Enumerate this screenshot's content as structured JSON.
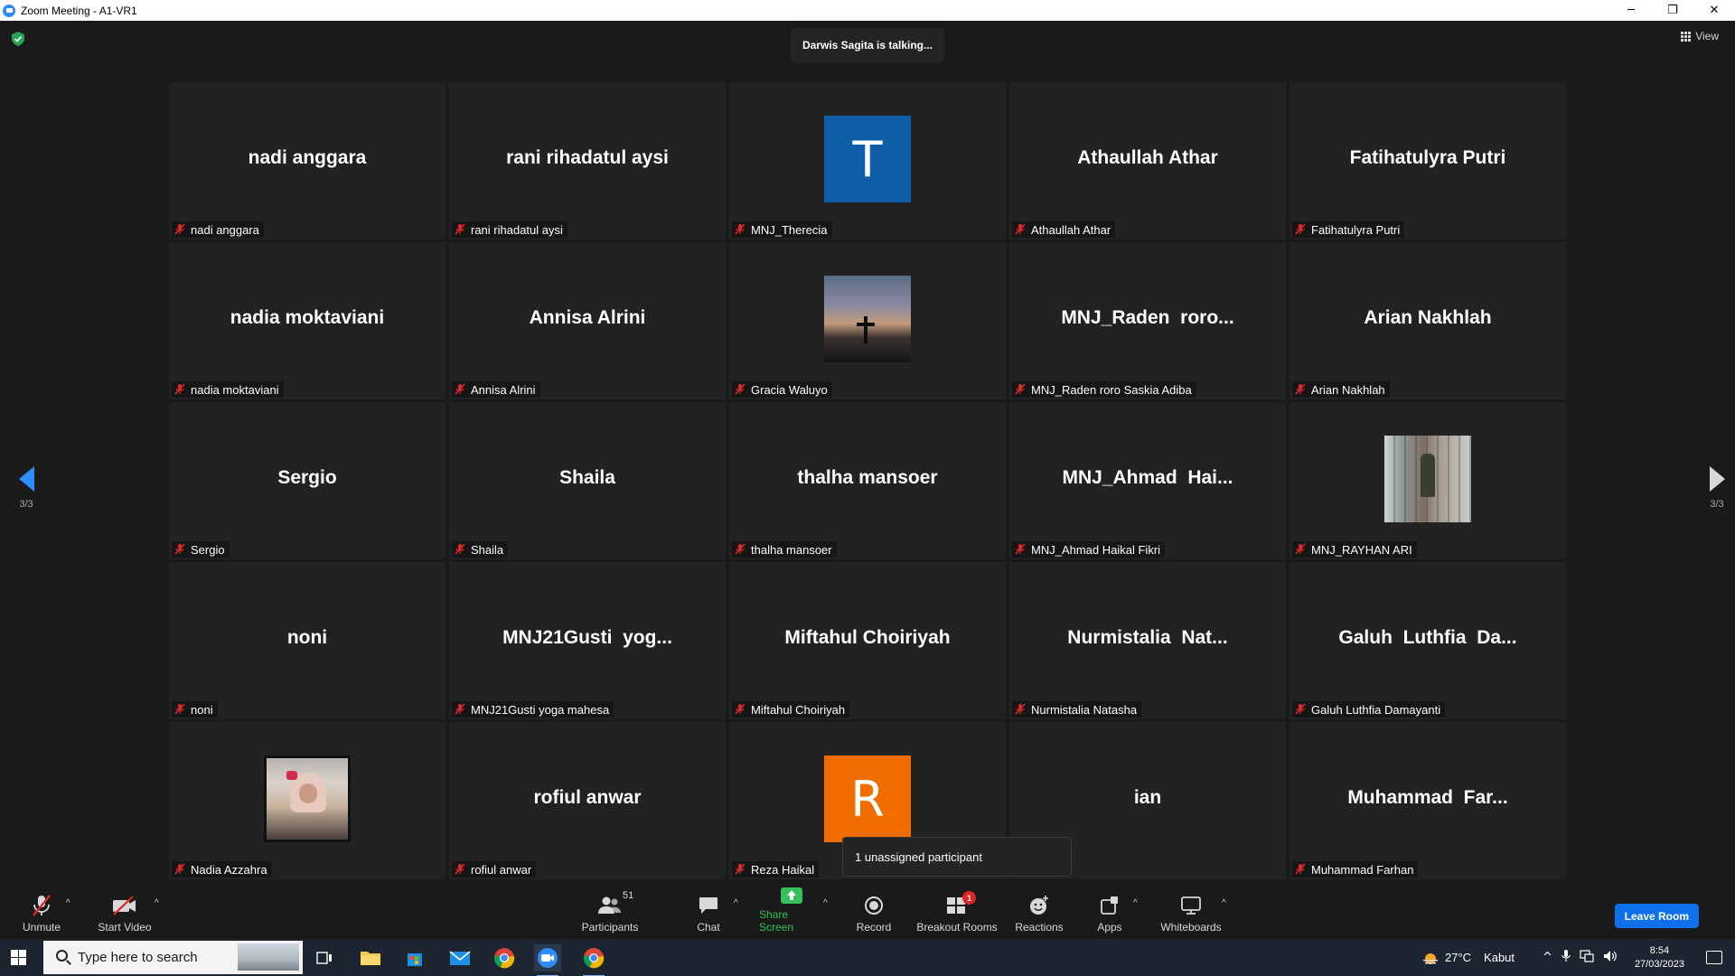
{
  "window": {
    "title": "Zoom Meeting - A1-VR1",
    "minimize": "─",
    "restore": "❐",
    "close": "✕"
  },
  "meeting": {
    "talking_indicator": "Darwis Sagita is talking...",
    "view_label": "View",
    "page_indicator_left": "3/3",
    "page_indicator_right": "3/3",
    "tiles": [
      {
        "display": "nadi anggara",
        "label": "nadi anggara",
        "avatar": null
      },
      {
        "display": "rani rihadatul aysi",
        "label": "rani rihadatul aysi",
        "avatar": null
      },
      {
        "display": "",
        "label": "MNJ_Therecia",
        "avatar": "letter",
        "letter": "T",
        "color": "#0e5ea8"
      },
      {
        "display": "Athaullah Athar",
        "label": "Athaullah Athar",
        "avatar": null
      },
      {
        "display": "Fatihatulyra Putri",
        "label": "Fatihatulyra Putri",
        "avatar": null
      },
      {
        "display": "nadia moktaviani",
        "label": "nadia moktaviani",
        "avatar": null
      },
      {
        "display": "Annisa Alrini",
        "label": "Annisa Alrini",
        "avatar": null
      },
      {
        "display": "",
        "label": "Gracia Waluyo",
        "avatar": "sunset"
      },
      {
        "display": "MNJ_Raden  roro...",
        "label": "MNJ_Raden roro Saskia Adiba",
        "avatar": null
      },
      {
        "display": "Arian Nakhlah",
        "label": "Arian Nakhlah",
        "avatar": null
      },
      {
        "display": "Sergio",
        "label": "Sergio",
        "avatar": null
      },
      {
        "display": "Shaila",
        "label": "Shaila",
        "avatar": null
      },
      {
        "display": "thalha mansoer",
        "label": "thalha mansoer",
        "avatar": null
      },
      {
        "display": "MNJ_Ahmad  Hai...",
        "label": "MNJ_Ahmad Haikal Fikri",
        "avatar": null
      },
      {
        "display": "",
        "label": "MNJ_RAYHAN ARI",
        "avatar": "bridge"
      },
      {
        "display": "noni",
        "label": "noni",
        "avatar": null
      },
      {
        "display": "MNJ21Gusti  yog...",
        "label": "MNJ21Gusti yoga mahesa",
        "avatar": null
      },
      {
        "display": "Miftahul Choiriyah",
        "label": "Miftahul Choiriyah",
        "avatar": null
      },
      {
        "display": "Nurmistalia  Nat...",
        "label": "Nurmistalia Natasha",
        "avatar": null
      },
      {
        "display": "Galuh  Luthfia  Da...",
        "label": "Galuh Luthfia Damayanti",
        "avatar": null
      },
      {
        "display": "",
        "label": "Nadia Azzahra",
        "avatar": "girl"
      },
      {
        "display": "rofiul anwar",
        "label": "rofiul anwar",
        "avatar": null
      },
      {
        "display": "",
        "label": "Reza Haikal",
        "avatar": "letter",
        "letter": "R",
        "color": "#f26d00"
      },
      {
        "display": "ian",
        "label": "",
        "avatar": null
      },
      {
        "display": "Muhammad  Far...",
        "label": "Muhammad Farhan",
        "avatar": null
      }
    ],
    "popover": "1 unassigned participant"
  },
  "toolbar": {
    "unmute": "Unmute",
    "start_video": "Start Video",
    "participants": "Participants",
    "participants_count": "51",
    "chat": "Chat",
    "share_screen": "Share Screen",
    "record": "Record",
    "breakout_rooms": "Breakout Rooms",
    "breakout_badge": "1",
    "reactions": "Reactions",
    "apps": "Apps",
    "whiteboards": "Whiteboards",
    "leave_room": "Leave Room"
  },
  "taskbar": {
    "search_placeholder": "Type here to search",
    "temperature": "27°C",
    "weather": "Kabut",
    "time": "8:54",
    "date": "27/03/2023"
  },
  "colors": {
    "accent": "#2d8cff",
    "muted_mic": "#e02828",
    "share_green": "#35c15a",
    "leave_blue": "#0e71eb"
  }
}
